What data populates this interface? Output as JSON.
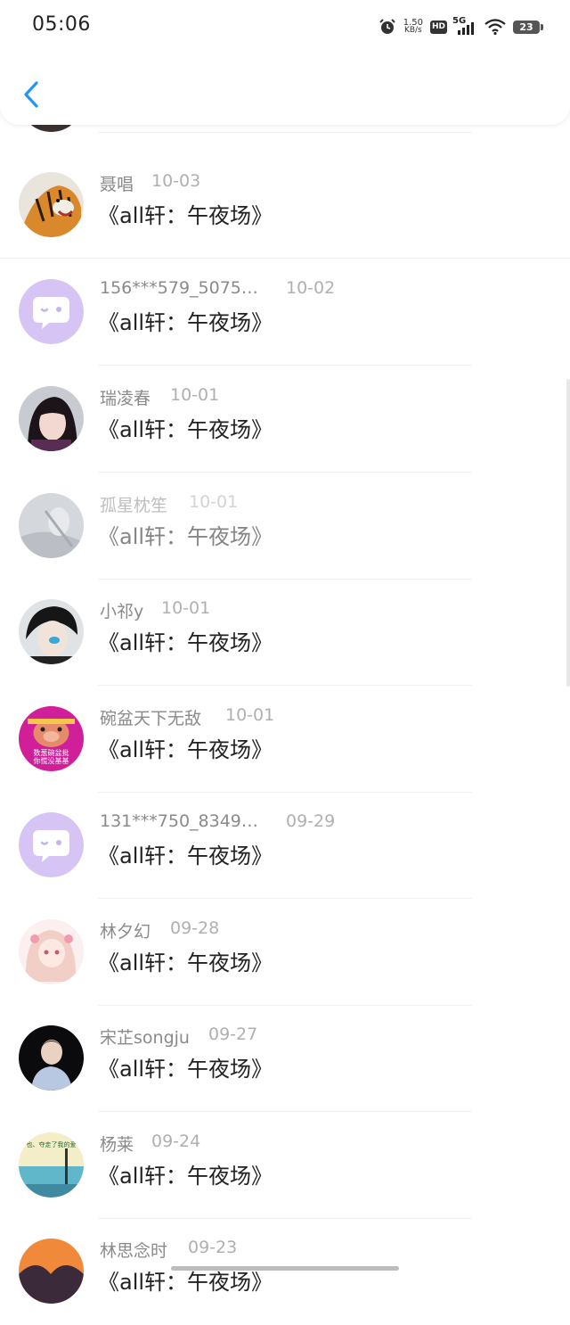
{
  "status": {
    "time": "05:06",
    "net_speed": "1.50",
    "net_unit": "KB/s",
    "hd": "HD",
    "network": "5G",
    "battery": "23"
  },
  "nav": {
    "back_icon": "chevron-left-icon"
  },
  "colors": {
    "accent": "#2196f3",
    "name": "#8a8a8a",
    "date": "#b0b0b0",
    "title": "#222222",
    "default_avatar": "#d6c4f5"
  },
  "entries": [
    {
      "name": "聂唱",
      "date": "10-03",
      "title": "《all轩：午夜场》",
      "avatar": "tiger-avatar"
    },
    {
      "name": "156***579_5075…",
      "date": "10-02",
      "title": "《all轩：午夜场》",
      "avatar": "default-chat-avatar"
    },
    {
      "name": "瑞凌春",
      "date": "10-01",
      "title": "《all轩：午夜场》",
      "avatar": "girl-photo-avatar"
    },
    {
      "name": "孤星枕笙",
      "date": "10-01",
      "title": "《all轩：午夜场》",
      "avatar": "blurry-photo-avatar"
    },
    {
      "name": "小祁y",
      "date": "10-01",
      "title": "《all轩：午夜场》",
      "avatar": "boy-photo-avatar"
    },
    {
      "name": "碗盆天下无敌",
      "date": "10-01",
      "title": "《all轩：午夜场》",
      "avatar": "cartoon-pig-avatar",
      "avatar_text": [
        "数葱碗盆批",
        "你慌没基基"
      ]
    },
    {
      "name": "131***750_8349…",
      "date": "09-29",
      "title": "《all轩：午夜场》",
      "avatar": "default-chat-avatar"
    },
    {
      "name": "林夕幻",
      "date": "09-28",
      "title": "《all轩：午夜场》",
      "avatar": "anime-girl-avatar"
    },
    {
      "name": "宋芷songju",
      "date": "09-27",
      "title": "《all轩：午夜场》",
      "avatar": "man-photo-avatar"
    },
    {
      "name": "杨莱",
      "date": "09-24",
      "title": "《all轩：午夜场》",
      "avatar": "seaside-avatar",
      "avatar_text": "也、夺走了我的爱"
    },
    {
      "name": "林思念时",
      "date": "09-23",
      "title": "《all轩：午夜场》",
      "avatar": "sunset-avatar"
    }
  ]
}
